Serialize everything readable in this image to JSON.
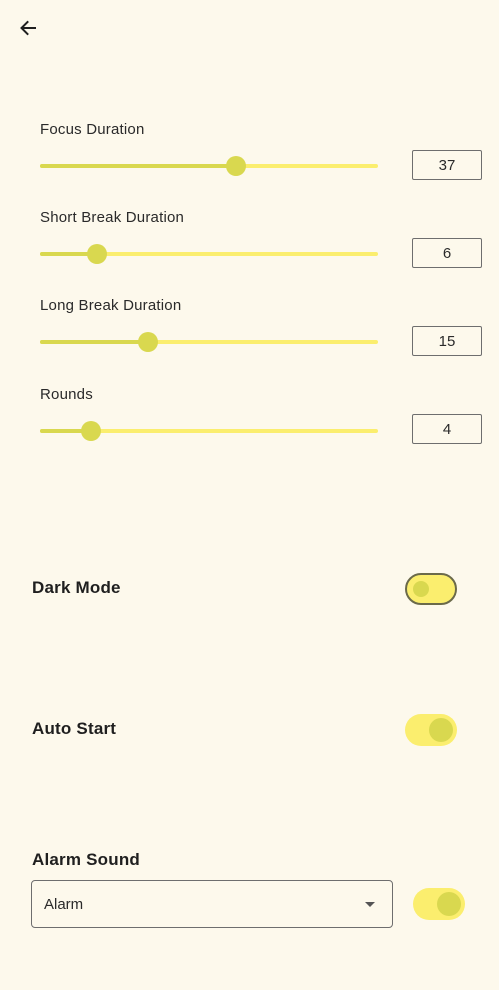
{
  "header": {
    "back_icon": "arrow-left-icon"
  },
  "sliders": [
    {
      "id": "focus",
      "label": "Focus Duration",
      "value": "37",
      "fraction": 0.58
    },
    {
      "id": "short-break",
      "label": "Short Break Duration",
      "value": "6",
      "fraction": 0.17
    },
    {
      "id": "long-break",
      "label": "Long Break Duration",
      "value": "15",
      "fraction": 0.32
    },
    {
      "id": "rounds",
      "label": "Rounds",
      "value": "4",
      "fraction": 0.15
    }
  ],
  "settings": {
    "dark_mode": {
      "label": "Dark Mode",
      "enabled": false
    },
    "auto_start": {
      "label": "Auto Start",
      "enabled": true
    },
    "alarm_sound": {
      "label": "Alarm Sound",
      "enabled": true,
      "selected": "Alarm"
    }
  },
  "colors": {
    "background": "#fdf9ec",
    "track": "#fbee6e",
    "accent": "#d9d84f",
    "outline": "#6e6e6e"
  }
}
